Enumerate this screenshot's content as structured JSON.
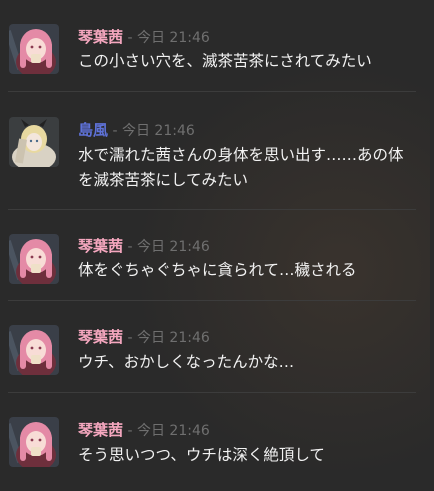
{
  "messages": [
    {
      "author": "琴葉茜",
      "separator": "-",
      "time": "今日 21:46",
      "text": "この小さい穴を、滅茶苦茶にされてみたい",
      "author_color": "#f5a7bf",
      "avatar": "akane-avatar"
    },
    {
      "author": "島風",
      "separator": "-",
      "time": "今日 21:46",
      "text": "水で濡れた茜さんの身体を思い出す……あの体を滅茶苦茶にしてみたい",
      "author_color": "#5e72d8",
      "avatar": "shimakaze-avatar"
    },
    {
      "author": "琴葉茜",
      "separator": "-",
      "time": "今日 21:46",
      "text": "体をぐちゃぐちゃに貪られて…穢される",
      "author_color": "#f5a7bf",
      "avatar": "akane-avatar"
    },
    {
      "author": "琴葉茜",
      "separator": "-",
      "time": "今日 21:46",
      "text": "ウチ、おかしくなったんかな…",
      "author_color": "#f5a7bf",
      "avatar": "akane-avatar"
    },
    {
      "author": "琴葉茜",
      "separator": "-",
      "time": "今日 21:46",
      "text": "そう思いつつ、ウチは深く絶頂して",
      "author_color": "#f5a7bf",
      "avatar": "akane-avatar"
    }
  ]
}
